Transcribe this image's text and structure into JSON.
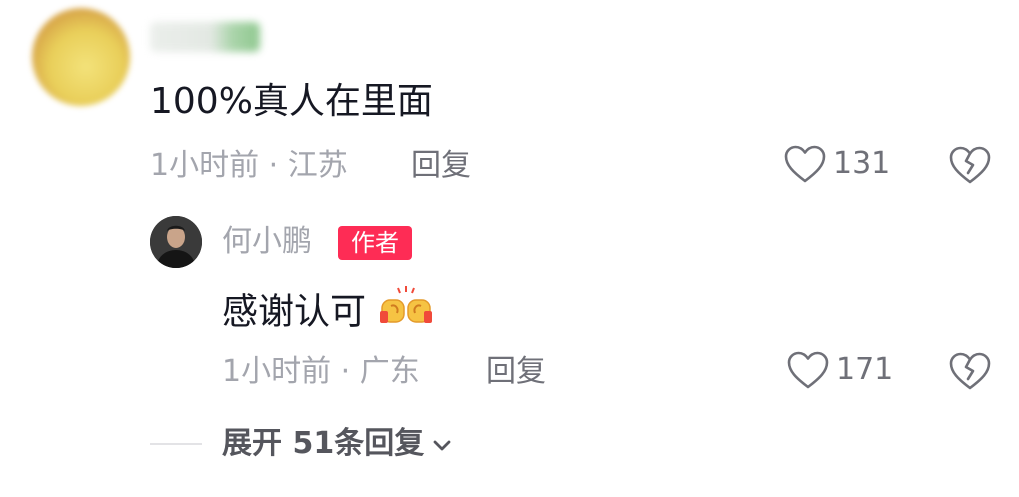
{
  "comment": {
    "text": "100%真人在里面",
    "time_location": "1小时前 · 江苏",
    "reply_label": "回复",
    "like_count": "131"
  },
  "reply": {
    "username": "何小鹏",
    "badge": "作者",
    "text": "感谢认可",
    "emoji_icon": "fist-bump-emoji",
    "time_location": "1小时前 · 广东",
    "reply_label": "回复",
    "like_count": "171"
  },
  "expand": {
    "label": "展开 51条回复"
  },
  "colors": {
    "badge": "#fe2c55",
    "text_primary": "#161823",
    "text_secondary": "#a3a5ad"
  }
}
